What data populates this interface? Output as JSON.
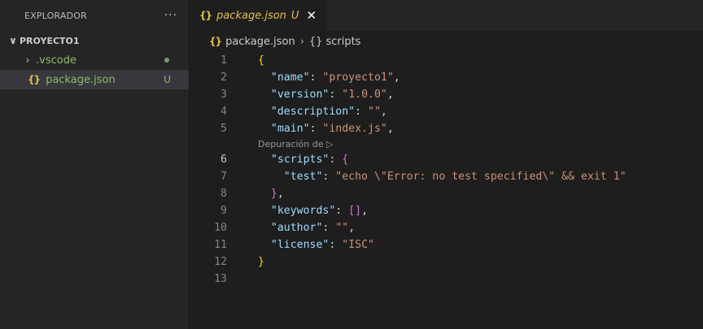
{
  "sidebar": {
    "title": "EXPLORADOR",
    "more": "···",
    "section": "PROYECTO1",
    "items": [
      {
        "label": ".vscode",
        "decoration": "dot"
      },
      {
        "label": "package.json",
        "decoration": "U"
      }
    ]
  },
  "tab": {
    "label": "package.json",
    "status": "U",
    "close": "✕"
  },
  "breadcrumb": {
    "file": "package.json",
    "symbol": "scripts"
  },
  "icons": {
    "json": "{}",
    "chevron_down": "∨",
    "chevron_right": "›"
  },
  "codelens": "Depuración de ▷",
  "code": {
    "lines": [
      {
        "n": "1",
        "tokens": [
          {
            "t": "{",
            "c": "b1"
          }
        ]
      },
      {
        "n": "2",
        "tokens": [
          {
            "t": "\"name\"",
            "c": "k"
          },
          {
            "t": ": ",
            "c": "p"
          },
          {
            "t": "\"proyecto1\"",
            "c": "s"
          },
          {
            "t": ",",
            "c": "p"
          }
        ]
      },
      {
        "n": "3",
        "tokens": [
          {
            "t": "\"version\"",
            "c": "k"
          },
          {
            "t": ": ",
            "c": "p"
          },
          {
            "t": "\"1.0.0\"",
            "c": "s"
          },
          {
            "t": ",",
            "c": "p"
          }
        ]
      },
      {
        "n": "4",
        "tokens": [
          {
            "t": "\"description\"",
            "c": "k"
          },
          {
            "t": ": ",
            "c": "p"
          },
          {
            "t": "\"\"",
            "c": "s"
          },
          {
            "t": ",",
            "c": "p"
          }
        ]
      },
      {
        "n": "5",
        "tokens": [
          {
            "t": "\"main\"",
            "c": "k"
          },
          {
            "t": ": ",
            "c": "p"
          },
          {
            "t": "\"index.js\"",
            "c": "s"
          },
          {
            "t": ",",
            "c": "p"
          }
        ]
      },
      {
        "n": "6",
        "tokens": [
          {
            "t": "\"scripts\"",
            "c": "k"
          },
          {
            "t": ": ",
            "c": "p"
          },
          {
            "t": "{",
            "c": "b2"
          }
        ]
      },
      {
        "n": "7",
        "tokens": [
          {
            "t": "\"test\"",
            "c": "k"
          },
          {
            "t": ": ",
            "c": "p"
          },
          {
            "t": "\"echo \\\"Error: no test specified\\\" && exit 1\"",
            "c": "s"
          }
        ]
      },
      {
        "n": "8",
        "tokens": [
          {
            "t": "}",
            "c": "b2"
          },
          {
            "t": ",",
            "c": "p"
          }
        ]
      },
      {
        "n": "9",
        "tokens": [
          {
            "t": "\"keywords\"",
            "c": "k"
          },
          {
            "t": ": ",
            "c": "p"
          },
          {
            "t": "[]",
            "c": "b2"
          },
          {
            "t": ",",
            "c": "p"
          }
        ]
      },
      {
        "n": "10",
        "tokens": [
          {
            "t": "\"author\"",
            "c": "k"
          },
          {
            "t": ": ",
            "c": "p"
          },
          {
            "t": "\"\"",
            "c": "s"
          },
          {
            "t": ",",
            "c": "p"
          }
        ]
      },
      {
        "n": "11",
        "tokens": [
          {
            "t": "\"license\"",
            "c": "k"
          },
          {
            "t": ": ",
            "c": "p"
          },
          {
            "t": "\"ISC\"",
            "c": "s"
          }
        ]
      },
      {
        "n": "12",
        "tokens": [
          {
            "t": "}",
            "c": "b1"
          }
        ]
      },
      {
        "n": "13",
        "tokens": []
      }
    ],
    "active_line": "6"
  },
  "colors": {
    "background": "#1e1e1e",
    "sidebar": "#252526",
    "json_icon": "#e2c04d",
    "untracked": "#8fb96a",
    "key": "#9cdcfe",
    "string": "#ce9178"
  }
}
